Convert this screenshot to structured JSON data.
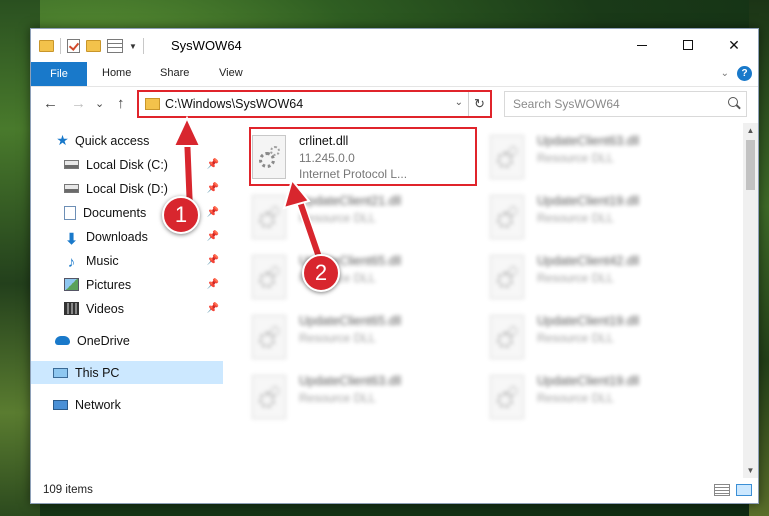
{
  "window": {
    "title": "SysWOW64",
    "minimize_glyph": "—",
    "maximize_glyph": "☐",
    "close_glyph": "✕"
  },
  "ribbon": {
    "tabs": [
      "File",
      "Home",
      "Share",
      "View"
    ],
    "help": "?"
  },
  "navigation": {
    "back": "←",
    "forward": "→",
    "recent": "⌄",
    "up": "↑",
    "address": "C:\\Windows\\SysWOW64",
    "refresh": "↻",
    "search_placeholder": "Search SysWOW64"
  },
  "sidebar": {
    "items": [
      {
        "label": "Quick access",
        "icon": "star-icon"
      },
      {
        "label": "Local Disk (C:)",
        "icon": "disk-icon",
        "pinned": true
      },
      {
        "label": "Local Disk (D:)",
        "icon": "disk-icon",
        "pinned": true
      },
      {
        "label": "Documents",
        "icon": "documents-icon",
        "pinned": true
      },
      {
        "label": "Downloads",
        "icon": "downloads-icon",
        "pinned": true
      },
      {
        "label": "Music",
        "icon": "music-icon",
        "pinned": true
      },
      {
        "label": "Pictures",
        "icon": "pictures-icon",
        "pinned": true
      },
      {
        "label": "Videos",
        "icon": "videos-icon",
        "pinned": true
      },
      {
        "label": "OneDrive",
        "icon": "onedrive-icon"
      },
      {
        "label": "This PC",
        "icon": "pc-icon",
        "selected": true
      },
      {
        "label": "Network",
        "icon": "network-icon"
      }
    ]
  },
  "files": [
    {
      "name": "crlinet.dll",
      "line2": "11.245.0.0",
      "line3": "Internet Protocol L...",
      "highlighted": true
    },
    {
      "name": "UpdateClient63.dll",
      "line2": "Resource DLL",
      "line3": ""
    },
    {
      "name": "UpdateClient21.dll",
      "line2": "Resource DLL",
      "line3": ""
    },
    {
      "name": "UpdateClient19.dll",
      "line2": "Resource DLL",
      "line3": ""
    },
    {
      "name": "UpdateClient65.dll",
      "line2": "Resource DLL",
      "line3": ""
    },
    {
      "name": "UpdateClient42.dll",
      "line2": "Resource DLL",
      "line3": ""
    },
    {
      "name": "UpdateClient65.dll",
      "line2": "Resource DLL",
      "line3": ""
    },
    {
      "name": "UpdateClient19.dll",
      "line2": "Resource DLL",
      "line3": ""
    },
    {
      "name": "UpdateClient63.dll",
      "line2": "Resource DLL",
      "line3": ""
    },
    {
      "name": "UpdateClient19.dll",
      "line2": "Resource DLL",
      "line3": ""
    }
  ],
  "status": {
    "item_count": "109 items"
  },
  "annotations": {
    "step1": "1",
    "step2": "2",
    "color": "#d8262e"
  }
}
